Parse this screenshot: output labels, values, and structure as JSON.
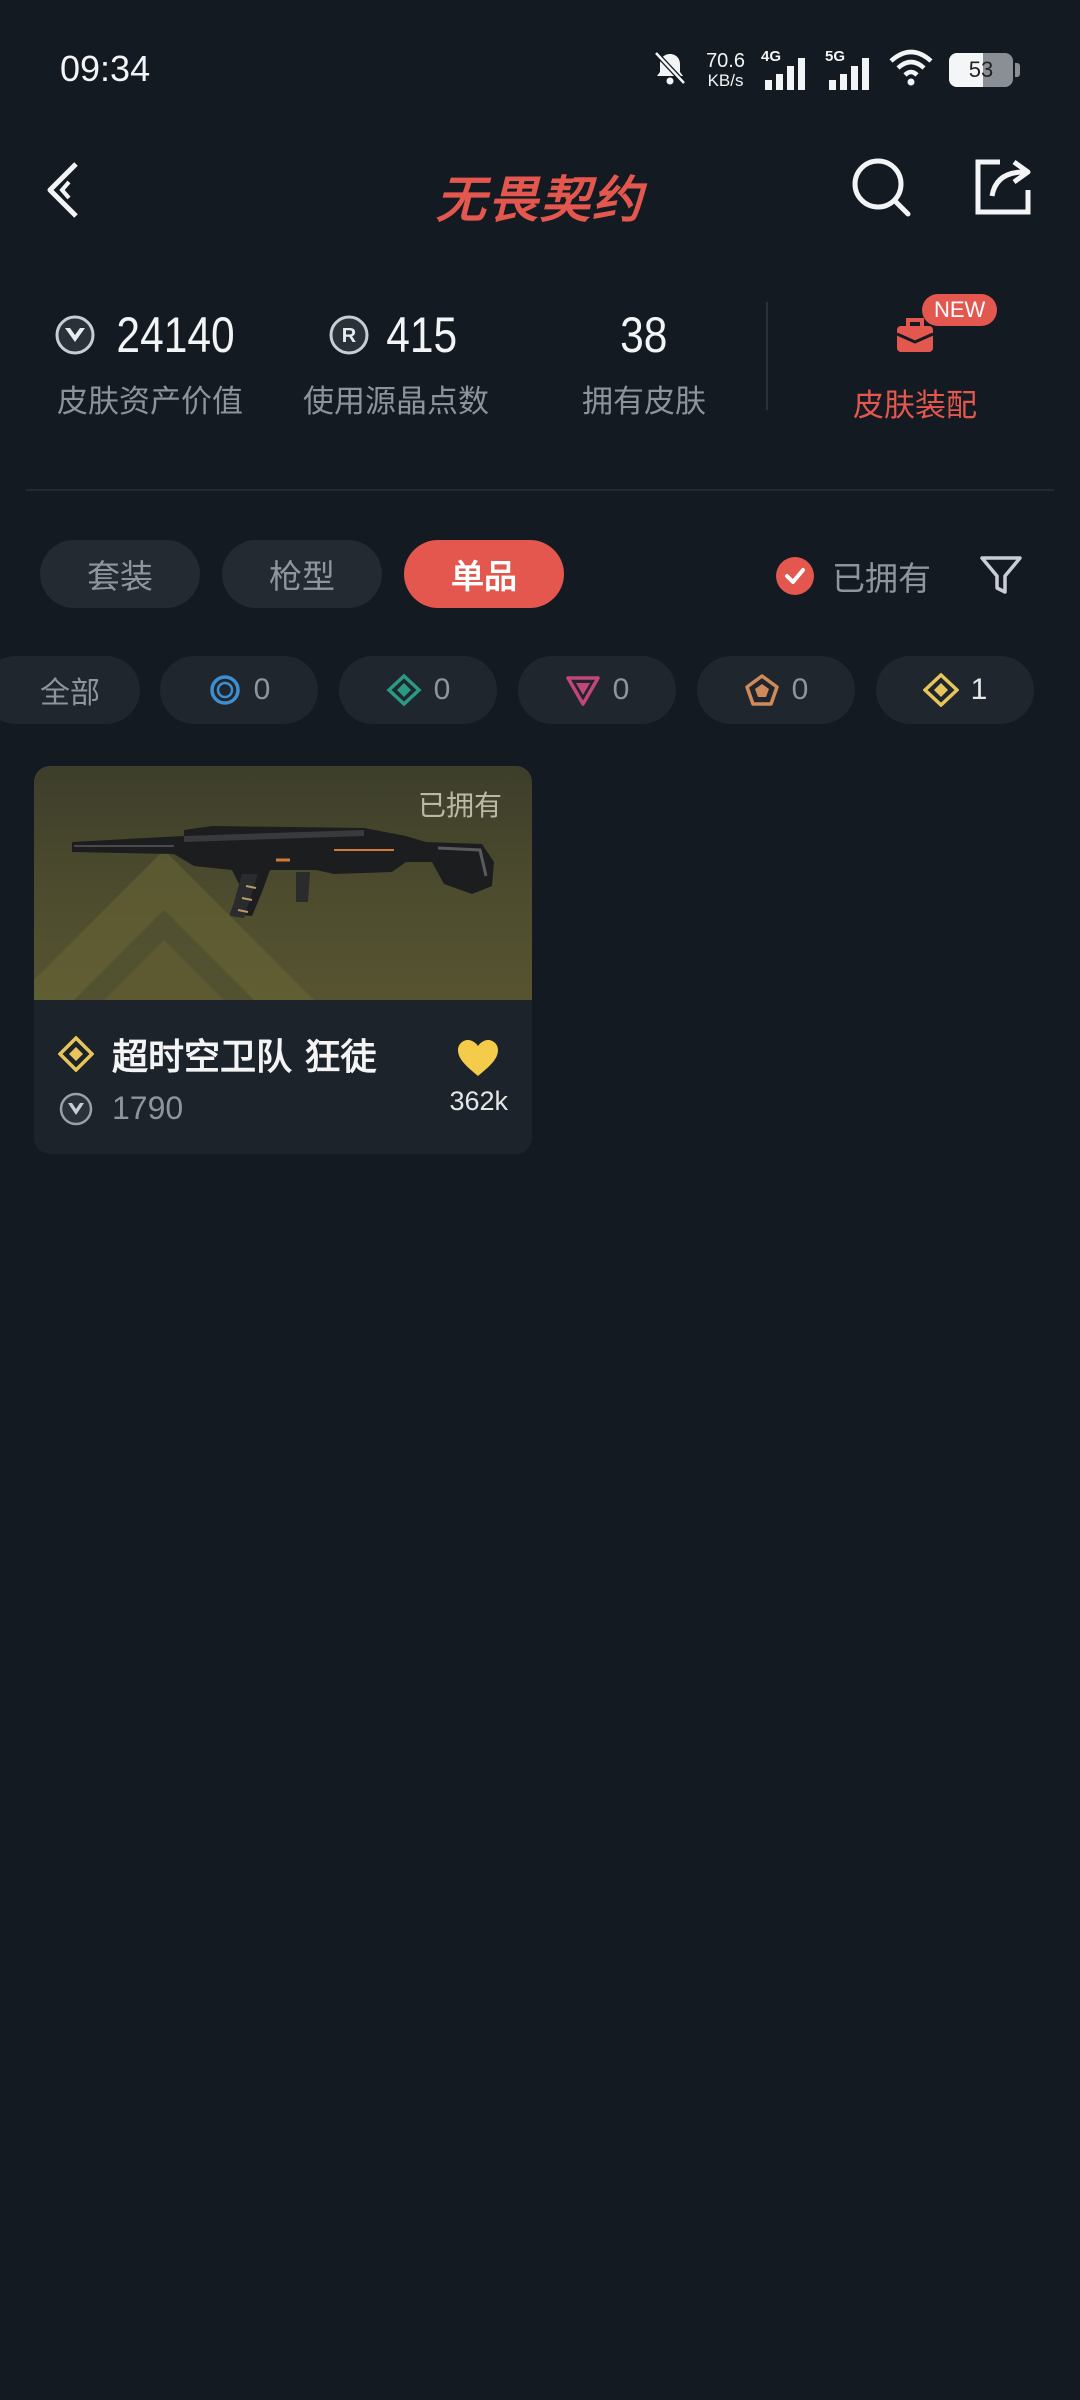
{
  "status_bar": {
    "time": "09:34",
    "net_speed_value": "70.6",
    "net_speed_unit": "KB/s",
    "signal_1_label": "4G",
    "signal_2_label": "5G",
    "battery_level": "53",
    "battery_fraction": 0.53,
    "icons": [
      "bell-mute-icon",
      "signal-icon",
      "wifi-icon",
      "battery-icon"
    ]
  },
  "header": {
    "title": "无畏契约",
    "accent_color": "#e3574f"
  },
  "stats": [
    {
      "value": "24140",
      "label": "皮肤资产价值",
      "icon": "valorant-points-icon"
    },
    {
      "value": "415",
      "label": "使用源晶点数",
      "icon": "radianite-icon"
    },
    {
      "value": "38",
      "label": "拥有皮肤"
    }
  ],
  "equip": {
    "badge": "NEW",
    "label": "皮肤装配"
  },
  "tabs": [
    {
      "label": "套装",
      "active": false
    },
    {
      "label": "枪型",
      "active": false
    },
    {
      "label": "单品",
      "active": true
    }
  ],
  "owned_filter": {
    "label": "已拥有",
    "checked": true
  },
  "rarity_chips": [
    {
      "label": "全部"
    },
    {
      "count": "0",
      "tier": "select",
      "color": "#3f8fd0"
    },
    {
      "count": "0",
      "tier": "deluxe",
      "color": "#2a9a85"
    },
    {
      "count": "0",
      "tier": "premium",
      "color": "#c2467a"
    },
    {
      "count": "0",
      "tier": "ultra",
      "color": "#d08a5a"
    },
    {
      "count": "1",
      "tier": "exclusive",
      "color": "#e8c55a"
    }
  ],
  "skin_card": {
    "owned_tag": "已拥有",
    "name": "超时空卫队 狂徒",
    "price": "1790",
    "likes": "362k",
    "tier_color": "#e8c55a"
  }
}
